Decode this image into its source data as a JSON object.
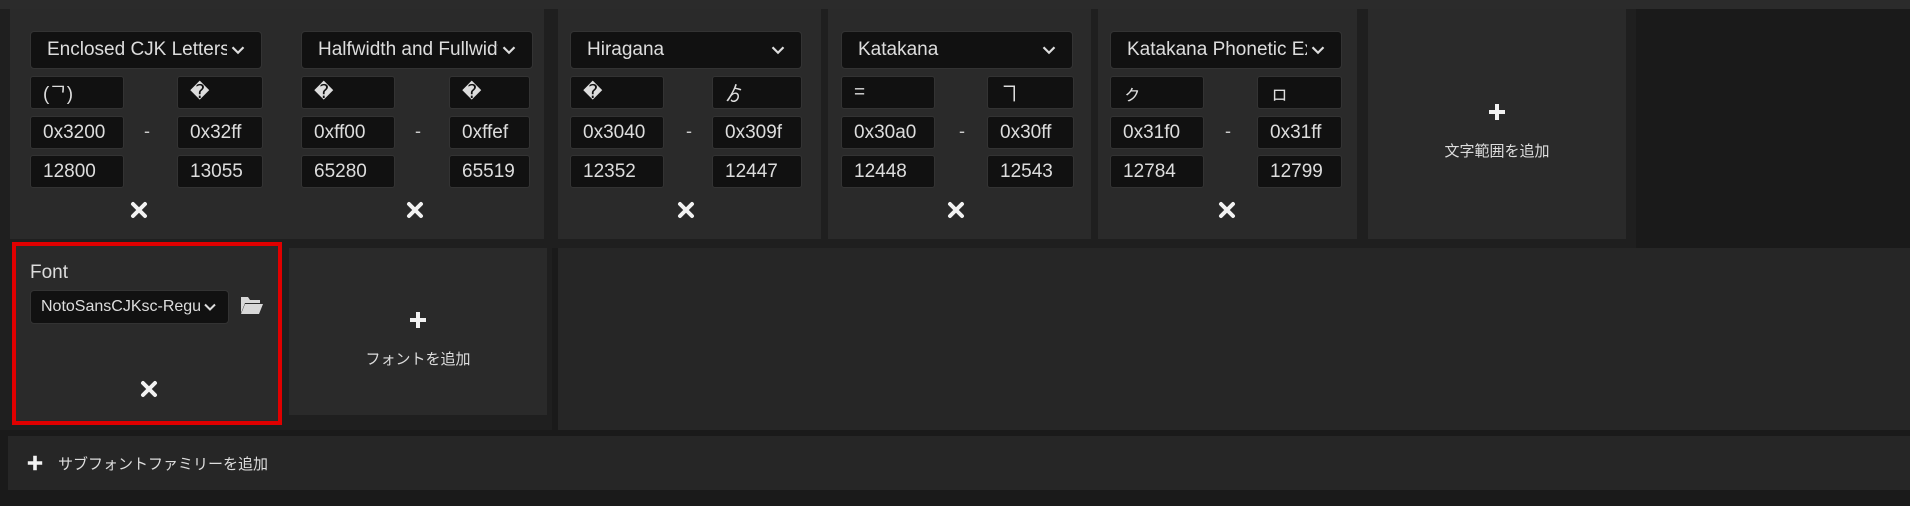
{
  "ranges": [
    {
      "name": "Enclosed CJK Letters and Months",
      "start_char": "(ᄀ)",
      "end_char": "�",
      "start_hex": "0x3200",
      "end_hex": "0x32ff",
      "start_dec": "12800",
      "end_dec": "13055"
    },
    {
      "name": "Halfwidth and Fullwidth Forms",
      "start_char": "�",
      "end_char": "�",
      "start_hex": "0xff00",
      "end_hex": "0xffef",
      "start_dec": "65280",
      "end_dec": "65519"
    },
    {
      "name": "Hiragana",
      "start_char": "�",
      "end_char": "ゟ",
      "start_hex": "0x3040",
      "end_hex": "0x309f",
      "start_dec": "12352",
      "end_dec": "12447"
    },
    {
      "name": "Katakana",
      "start_char": "=",
      "end_char": "ヿ",
      "start_hex": "0x30a0",
      "end_hex": "0x30ff",
      "start_dec": "12448",
      "end_dec": "12543"
    },
    {
      "name": "Katakana Phonetic Extensions",
      "start_char": "ㇰ",
      "end_char": "ㇿ",
      "start_hex": "0x31f0",
      "end_hex": "0x31ff",
      "start_dec": "12784",
      "end_dec": "12799"
    }
  ],
  "dash": "-",
  "add_range_label": "文字範囲を追加",
  "font": {
    "title": "Font",
    "selected": "NotoSansCJKsc-Regular"
  },
  "add_font_label": "フォントを追加",
  "add_subfamily_label": "サブフォントファミリーを追加",
  "icons": {
    "dropdown": "chevron-down-icon",
    "remove": "close-icon",
    "add": "plus-icon",
    "folder": "folder-open-icon"
  }
}
